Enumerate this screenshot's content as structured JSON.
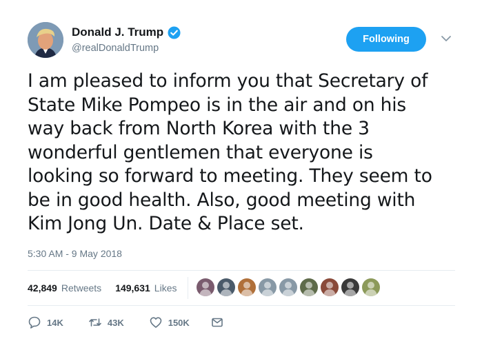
{
  "author": {
    "name": "Donald J. Trump",
    "handle": "@realDonaldTrump",
    "verified": true,
    "avatar_icon": "avatar-portrait"
  },
  "follow_button": {
    "label": "Following",
    "color": "#1da1f2"
  },
  "menu_icon": "chevron-down-icon",
  "tweet": {
    "text": "I am pleased to inform you that Secretary of\nState Mike Pompeo is in the air and on his\nway back from North Korea with the 3\nwonderful gentlemen that everyone is\nlooking so forward to meeting. They seem to\nbe in good health. Also, good meeting with\nKim Jong Un. Date & Place set.",
    "timestamp": "5:30 AM - 9 May 2018"
  },
  "stats": {
    "retweets_count": "42,849",
    "retweets_label": "Retweets",
    "likes_count": "149,631",
    "likes_label": "Likes"
  },
  "likers": [
    "#7a5b6e",
    "#4a5a6a",
    "#b0703a",
    "#8899a6",
    "#8899a6",
    "#5e6b4a",
    "#8a4a3a",
    "#3a3a3a",
    "#8c9a5a"
  ],
  "actions": {
    "reply_count": "14K",
    "retweet_count": "43K",
    "like_count": "150K"
  }
}
